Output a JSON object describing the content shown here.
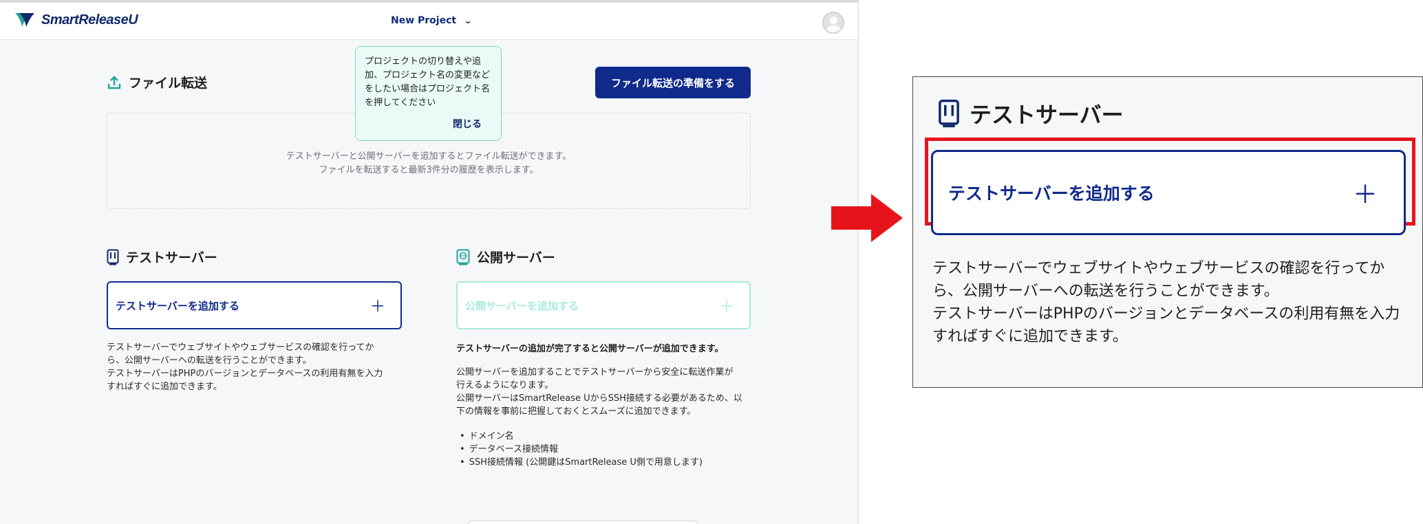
{
  "app": {
    "logo_text": "SmartReleaseU",
    "project_selector": {
      "label": "New Project",
      "icon": "chevron-down-icon"
    },
    "avatar_icon": "user-avatar-icon",
    "file_transfer": {
      "title": "ファイル転送",
      "icon": "upload-icon",
      "button_label": "ファイル転送の準備をする",
      "empty_line1": "テストサーバーと公開サーバーを追加するとファイル転送ができます。",
      "empty_line2": "ファイルを転送すると最新3件分の履歴を表示します。"
    },
    "tooltip": {
      "message": "プロジェクトの切り替えや追\n加、プロジェクト名の変更など\nをしたい場合はプロジェクト名\nを押してください",
      "close_label": "閉じる"
    },
    "test_server": {
      "title": "テストサーバー",
      "icon": "test-server-icon",
      "add_label": "テストサーバーを追加する",
      "plus": "＋",
      "description": "テストサーバーでウェブサイトやウェブサービスの確認を行ってか\nら、公開サーバーへの転送を行うことができます。\nテストサーバーはPHPのバージョンとデータベースの利用有無を入力\nすればすぐに追加できます。"
    },
    "public_server": {
      "title": "公開サーバー",
      "icon": "public-server-icon",
      "add_label": "公開サーバーを追加する",
      "plus": "＋",
      "notice": "テストサーバーの追加が完了すると公開サーバーが追加できます。",
      "description": "公開サーバーを追加することでテストサーバーから安全に転送作業が\n行えるようになります。\n公開サーバーはSmartRelease UからSSH接続する必要があるため、以\n下の情報を事前に把握しておくとスムーズに追加できます。",
      "list": [
        "ドメイン名",
        "データベース接続情報",
        "SSH接続情報 (公開鍵はSmartRelease U側で用意します)"
      ]
    }
  },
  "zoom_panel": {
    "title": "テストサーバー",
    "add_label": "テストサーバーを追加する",
    "plus": "＋",
    "description": "テストサーバーでウェブサイトやウェブサービスの確認を行ってか\nら、公開サーバーへの転送を行うことができます。\nテストサーバーはPHPのバージョンとデータベースの利用有無を入力\nすればすぐに追加できます。"
  },
  "colors": {
    "brand_navy": "#0f2a8a",
    "disabled_mint": "#a8ebdd",
    "tooltip_bg": "#eafaf6",
    "highlight_red": "#e8141b",
    "icon_teal": "#1aa596"
  }
}
